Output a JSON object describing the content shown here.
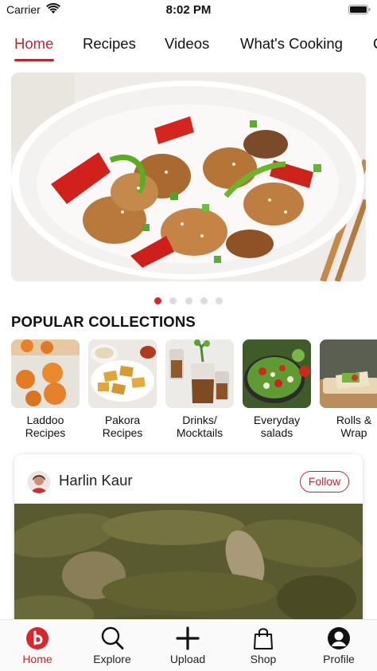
{
  "status_bar": {
    "carrier": "Carrier",
    "time": "8:02 PM"
  },
  "top_tabs": [
    {
      "label": "Home",
      "active": true
    },
    {
      "label": "Recipes",
      "active": false
    },
    {
      "label": "Videos",
      "active": false
    },
    {
      "label": "What's Cooking",
      "active": false
    },
    {
      "label": "C",
      "active": false
    }
  ],
  "hero": {
    "image": "chicken-stir-fry-photo",
    "slide_count": 5,
    "active_slide": 1
  },
  "popular_collections": {
    "title": "POPULAR COLLECTIONS",
    "items": [
      {
        "line1": "Laddoo",
        "line2": "Recipes",
        "image": "laddoo-photo"
      },
      {
        "line1": "Pakora",
        "line2": "Recipes",
        "image": "pakora-photo"
      },
      {
        "line1": "Drinks/",
        "line2": "Mocktails",
        "image": "drinks-photo"
      },
      {
        "line1": "Everyday",
        "line2": "salads",
        "image": "salad-photo"
      },
      {
        "line1": "Rolls &",
        "line2": "Wrap",
        "image": "wrap-photo"
      }
    ]
  },
  "post": {
    "author": "Harlin Kaur",
    "follow_label": "Follow",
    "image": "green-curry-photo"
  },
  "bottom_nav": [
    {
      "label": "Home",
      "icon": "home-logo-icon",
      "active": true
    },
    {
      "label": "Explore",
      "icon": "search-icon",
      "active": false
    },
    {
      "label": "Upload",
      "icon": "plus-icon",
      "active": false
    },
    {
      "label": "Shop",
      "icon": "shopping-bag-icon",
      "active": false
    },
    {
      "label": "Profile",
      "icon": "profile-icon",
      "active": false
    }
  ],
  "colors": {
    "accent": "#c0272d",
    "dot_active": "#d8262f",
    "dot_inactive": "#dcdcdc"
  }
}
